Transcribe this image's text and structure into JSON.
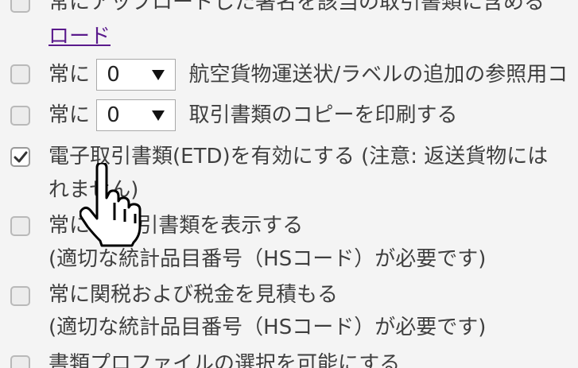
{
  "options": [
    {
      "id": "include-signature",
      "checked": false,
      "lines": [
        "常にアップロードした署名を該当の取引書類に含める",
        "ロード"
      ]
    },
    {
      "id": "airwaybill-copies",
      "checked": false,
      "prefix": "常に",
      "select_value": "0",
      "suffix": "航空貨物運送状/ラベルの追加の参照用コ"
    },
    {
      "id": "print-copies",
      "checked": false,
      "prefix": "常に",
      "select_value": "0",
      "suffix": "取引書類のコピーを印刷する"
    },
    {
      "id": "enable-etd",
      "checked": true,
      "lines": [
        "電子取引書類(ETD)を有効にする (注意: 返送貨物には",
        "れません)"
      ]
    },
    {
      "id": "show-documents",
      "checked": false,
      "lines": [
        "常に    の取引書類を表示する",
        "(適切な統計品目番号（HSコード）が必要です)"
      ]
    },
    {
      "id": "estimate-duties",
      "checked": false,
      "lines": [
        "常に関税および税金を見積もる",
        "(適切な統計品目番号（HSコード）が必要です)"
      ]
    },
    {
      "id": "document-profile",
      "checked": false,
      "lines": [
        "書類プロファイルの選択を可能にする"
      ]
    }
  ]
}
